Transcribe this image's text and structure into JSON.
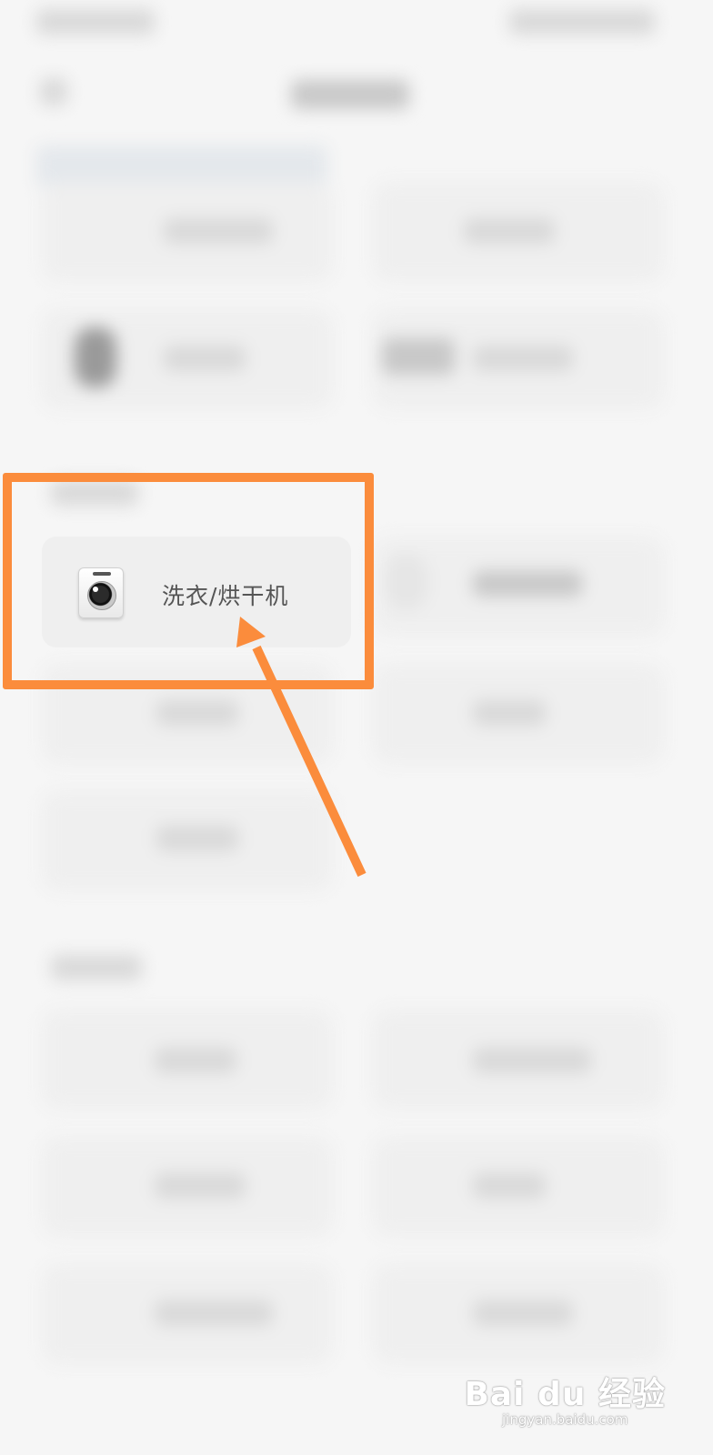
{
  "focused_item": {
    "label": "洗衣/烘干机",
    "icon": "washing-machine-icon"
  },
  "annotation": {
    "highlight_color": "#fb8c3c",
    "arrow_color": "#fb8c3c"
  },
  "watermark": {
    "logo": "Bai du 经验",
    "url": "jingyan.baidu.com"
  }
}
